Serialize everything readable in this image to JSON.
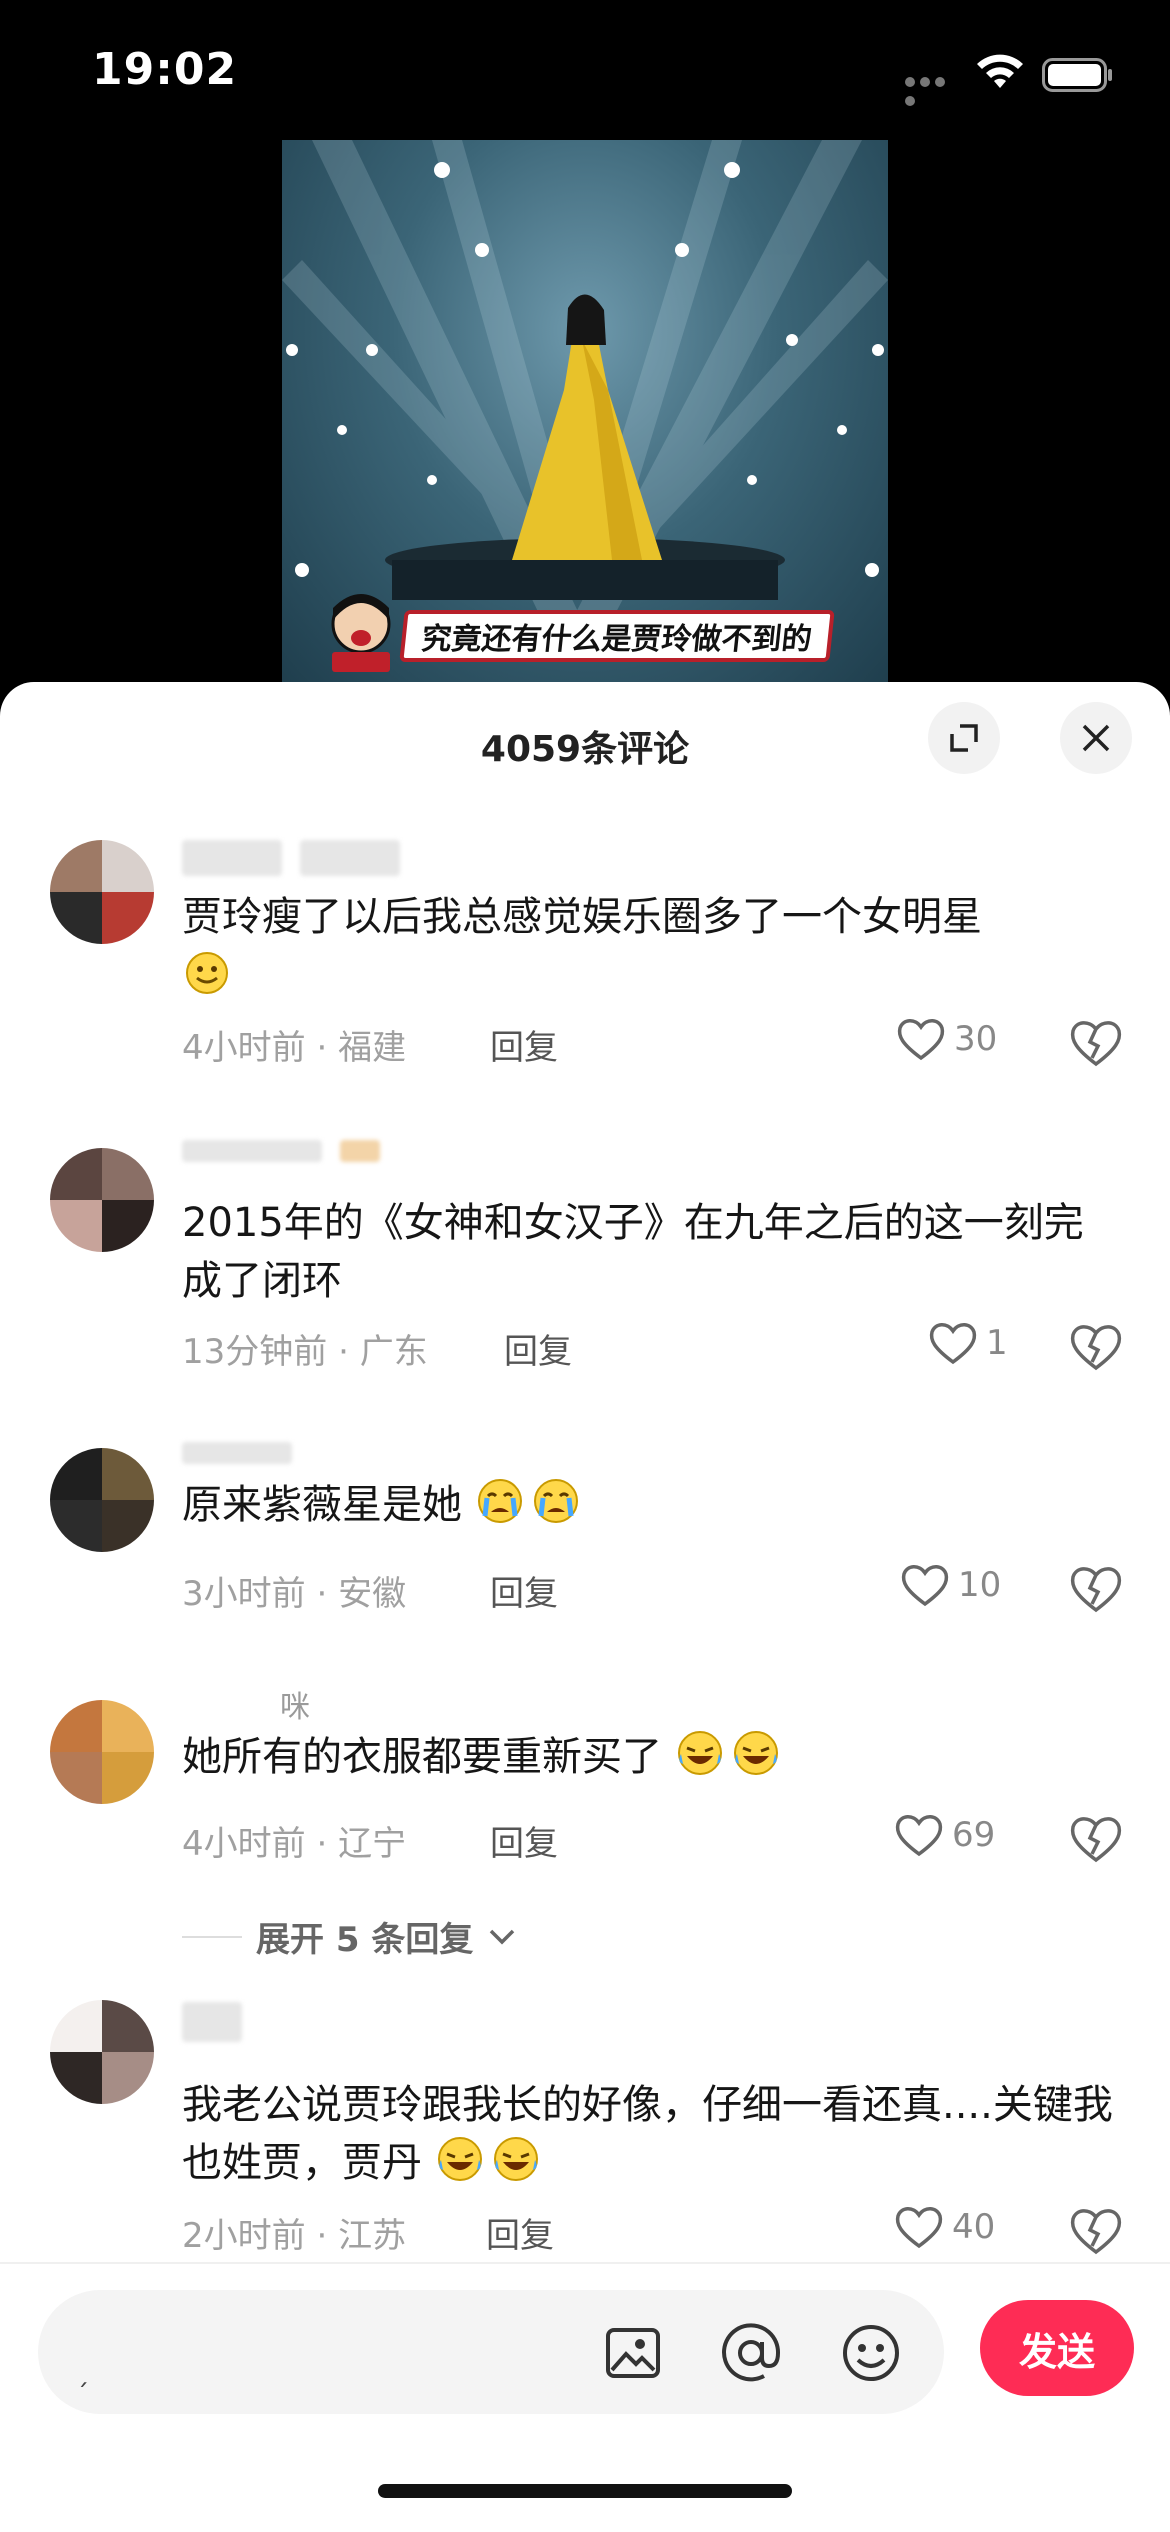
{
  "status_bar": {
    "time": "19:02"
  },
  "video": {
    "caption": "究竟还有什么是贾玲做不到的"
  },
  "sheet": {
    "title": "4059条评论"
  },
  "comments": [
    {
      "username": "",
      "text": "贾玲瘦了以后我总感觉娱乐圈多了一个女明星",
      "time": "4小时前",
      "location": "福建",
      "likes": "30",
      "reply_label": "回复"
    },
    {
      "username": "",
      "text": "2015年的《女神和女汉子》在九年之后的这一刻完成了闭环",
      "time": "13分钟前",
      "location": "广东",
      "likes": "1",
      "reply_label": "回复"
    },
    {
      "username": "",
      "text": "原来紫薇星是她",
      "time": "3小时前",
      "location": "安徽",
      "likes": "10",
      "reply_label": "回复"
    },
    {
      "username": "咪",
      "text": "她所有的衣服都要重新买了",
      "time": "4小时前",
      "location": "辽宁",
      "likes": "69",
      "reply_label": "回复"
    },
    {
      "username": "",
      "text": "我老公说贾玲跟我长的好像，仔细一看还真....关键我也姓贾，贾丹",
      "time": "2小时前",
      "location": "江苏",
      "likes": "40",
      "reply_label": "回复"
    }
  ],
  "expand_replies": "展开 5 条回复",
  "input": {
    "send_label": "发送"
  },
  "icons": [
    "wifi-icon",
    "battery-icon",
    "expand-icon",
    "close-icon",
    "heart-icon",
    "broken-heart-icon",
    "image-icon",
    "at-icon",
    "emoji-icon",
    "chevron-down-icon"
  ],
  "colors": {
    "accent": "#fe2c55"
  }
}
